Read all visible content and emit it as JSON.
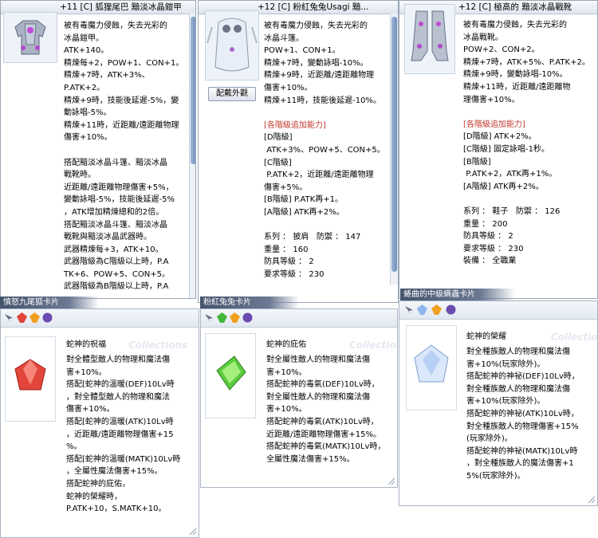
{
  "items": [
    {
      "title": "+11 [C] 狐狸尾巴 黯淡冰晶鎧甲",
      "lines": [
        "被有毒魔力侵蝕，失去光彩的",
        "冰晶鎧甲。",
        "ATK+140。",
        "精煉每+2，POW+1、CON+1。",
        "精煉+7時，ATK+3%、P.ATK+2。",
        "精煉+9時，技能後延遲-5%，變",
        "動詠唱-5%。",
        "精煉+11時，近距離/遠距離物理",
        "傷害+10%。",
        "",
        "搭配黯淡冰晶斗篷、黯淡冰晶",
        "戰靴時。",
        "近距離/遠距離物理傷害+5%，",
        "變動詠唱-5%，技能後延遲-5%",
        "，ATK增加精煉總和的2倍。",
        "搭配黯淡冰晶斗篷、黯淡冰晶",
        "戰靴與黯淡冰晶武器時。",
        "武器精煉每+3，ATK+10。",
        "武器階級為C階級以上時，P.A",
        "TK+6、POW+5、CON+5。",
        "武器階級為B階級以上時，P.A"
      ]
    },
    {
      "title": "+12 [C] 粉紅兔兔Usagi 黯...",
      "button": "配戴外觀",
      "lines": [
        "被有毒魔力侵蝕，失去光彩的",
        "冰晶斗篷。",
        "POW+1、CON+1。",
        "精煉+7時，變動詠唱-10%。",
        "精煉+9時，近距離/遠距離物理",
        "傷害+10%。",
        "精煉+11時，技能後延遲-10%。",
        "",
        "[各階級追加能力]",
        "[D階級]",
        " ATK+3%、POW+5、CON+5。",
        "[C階級]",
        " P.ATK+2，近距離/遠距離物理",
        "傷害+5%。",
        "[B階級] P.ATK再+1。",
        "[A階級] ATK再+2%。",
        "",
        "系列 ： 披肩   防禦 ： 147",
        "重量 ： 160",
        "防具等級 ： 2",
        "要求等級 ： 230"
      ]
    },
    {
      "title": "+12 [C] 極高的 黯淡冰晶戰靴",
      "lines": [
        "被有毒魔力侵蝕，失去光彩的",
        "冰晶戰靴。",
        "POW+2、CON+2。",
        "精煉+7時，ATK+5%、P.ATK+2。",
        "精煉+9時，變動詠唱-10%。",
        "精煉+11時，近距離/遠距離物",
        "理傷害+10%。",
        "",
        "[各階級追加能力]",
        "[D階級] ATK+2%。",
        "[C階級] 固定詠唱-1秒。",
        "[B階級]",
        " P.ATK+2，ATK再+1%。",
        "[A階級] ATK再+2%。",
        "",
        "系列 ： 鞋子   防禦 ： 126",
        "重量 ： 200",
        "防具等級 ： 2",
        "要求等級 ： 230",
        "裝備 ： 全職業"
      ]
    }
  ],
  "cards": [
    {
      "banner": "憤怒九尾狐卡片",
      "name": "蛇神的祝福",
      "watermark": "Collections",
      "lines": [
        "對全體型敵人的物理和魔法傷",
        "害+10%。",
        "搭配[蛇神的溫暖(DEF)10Lv時",
        "，對全體型敵人的物理和魔法",
        "傷害+10%。",
        "搭配[蛇神的溫暖(ATK)10Lv時",
        "，近距離/遠距離物理傷害+15",
        "%。",
        "搭配[蛇神的溫暖(MATK)10Lv時",
        "，全屬性魔法傷害+15%。",
        "搭配蛇神的庇佑，",
        "蛇神的榮耀時，",
        "P.ATK+10，S.MATK+10。"
      ]
    },
    {
      "banner": "粉紅兔兔卡片",
      "name": "蛇神的庇佑",
      "watermark": "Collections",
      "lines": [
        "對全屬性敵人的物理和魔法傷",
        "害+10%。",
        "搭配蛇神的毒氣(DEF)10Lv時，",
        "對全屬性敵人的物理和魔法傷",
        "害+10%。",
        "搭配蛇神的毒氣(ATK)10Lv時，",
        "近距離/遠距離物理傷害+15%。",
        "搭配蛇神的毒氣(MATK)10Lv時，",
        "全屬性魔法傷害+15%。"
      ]
    },
    {
      "banner": "蜷曲的中級螨蟲卡片",
      "name": "蛇神的榮耀",
      "watermark": "Collections",
      "lines": [
        "對全種族敵人的物理和魔法傷",
        "害+10%(玩家除外)。",
        "搭配蛇神的神祕(DEF)10Lv時，",
        "對全種族敵人的物理和魔法傷",
        "害+10%(玩家除外)。",
        "搭配蛇神的神祕(ATK)10Lv時，",
        "對全種族敵人的物理傷害+15%",
        "(玩家除外)。",
        "搭配蛇神的神祕(MATK)10Lv時",
        "，對全種族敵人的魔法傷害+1",
        "5%(玩家除外)。"
      ]
    }
  ],
  "colors": {
    "header_red": "#c0392b",
    "banner_bg": "#44546c",
    "scroll_thumb": "#6f8fbd"
  },
  "icons": [
    "item-arrow-icon",
    "red-gem-icon",
    "green-gem-icon",
    "orange-gem-icon",
    "purple-gem-icon",
    "blue-gem-icon",
    "resize-grip-icon"
  ]
}
